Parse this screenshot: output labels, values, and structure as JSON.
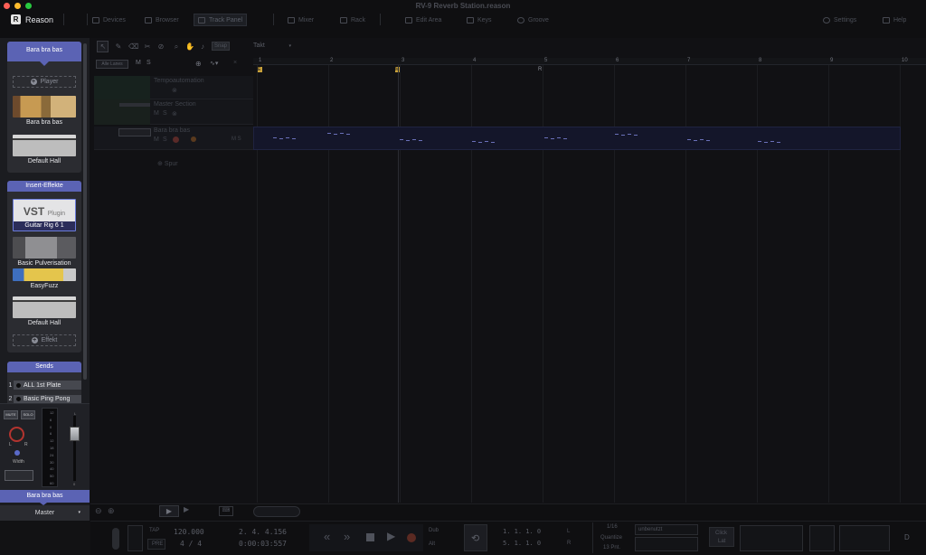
{
  "window": {
    "traffic_colors": [
      "#fe5f57",
      "#febc2e",
      "#28c840"
    ],
    "app_name": "Reason",
    "document_title": "RV-9 Reverb Station.reason"
  },
  "topnav": [
    {
      "label": "Devices"
    },
    {
      "label": "Browser"
    },
    {
      "label": "Track Panel"
    },
    {
      "label": "Mixer"
    },
    {
      "label": "Rack"
    },
    {
      "label": "Edit Area"
    },
    {
      "label": "Keys"
    },
    {
      "label": "Groove"
    },
    {
      "label": "Settings"
    },
    {
      "label": "Help"
    }
  ],
  "player_card": {
    "header": "Bara bra bas",
    "add_player_label": "Player",
    "devices": [
      {
        "label": "Bara bra bas"
      },
      {
        "label": "Default Hall"
      }
    ]
  },
  "insert_card": {
    "header": "Insert-Effekte",
    "vst": {
      "title": "VST",
      "subtitle": "Plugin",
      "name": "Guitar Rig 6 1"
    },
    "devices": [
      {
        "label": "Basic Pulverisation"
      },
      {
        "label": "EasyFuzz"
      },
      {
        "label": "Default Hall"
      }
    ],
    "add_effect_label": "Effekt"
  },
  "sends": {
    "header": "Sends",
    "items": [
      {
        "num": "1",
        "label": "ALL 1st Plate"
      },
      {
        "num": "2",
        "label": "Basic Ping Pong"
      }
    ]
  },
  "mixer_strip": {
    "mute_label": "MUTE",
    "solo_label": "SOLO",
    "pan_l": "L",
    "pan_r": "R",
    "width_label": "Width",
    "meter_scale": [
      "12",
      "6",
      "0",
      "6",
      "12",
      "18",
      "24",
      "30",
      "40",
      "50",
      "60"
    ],
    "fader_top_label": "L",
    "fader_bottom_label": "0",
    "channel_name": "Bara bra bas",
    "routing": "Master"
  },
  "sequencer": {
    "toolbar": {
      "snap_label": "Snap",
      "snap_value": "Takt"
    },
    "lane_button": "Alle Lanes",
    "ms_labels": [
      "M",
      "S"
    ],
    "bars": [
      "1",
      "2",
      "3",
      "4",
      "5",
      "6",
      "7",
      "8",
      "9",
      "10"
    ],
    "markers": [
      "E",
      "M",
      "R"
    ],
    "tracks": [
      {
        "name": "Tempoautomation"
      },
      {
        "name": "Master Section"
      },
      {
        "name": "Bara bra bas"
      }
    ],
    "add_track_label": "Spur"
  },
  "transport": {
    "tempo": "120.000",
    "signature": "4 / 4",
    "position": "2. 4. 4.156",
    "time": "0:00:03:557",
    "loop_start": "1.  1.  1.    0",
    "loop_end": "5.  1.  1.    0",
    "tap_label": "TAP",
    "pre_label": "PRE",
    "dub_label": "Dub",
    "alt_label": "Alt",
    "quantize_value": "1/16",
    "quantize_label": "Quantize",
    "quantize_pct": "13 Pnt.",
    "lr_labels": [
      "L",
      "R"
    ],
    "device_label": "unbenutzt",
    "ca_label": "Click",
    "ca_sub": "Lat"
  }
}
